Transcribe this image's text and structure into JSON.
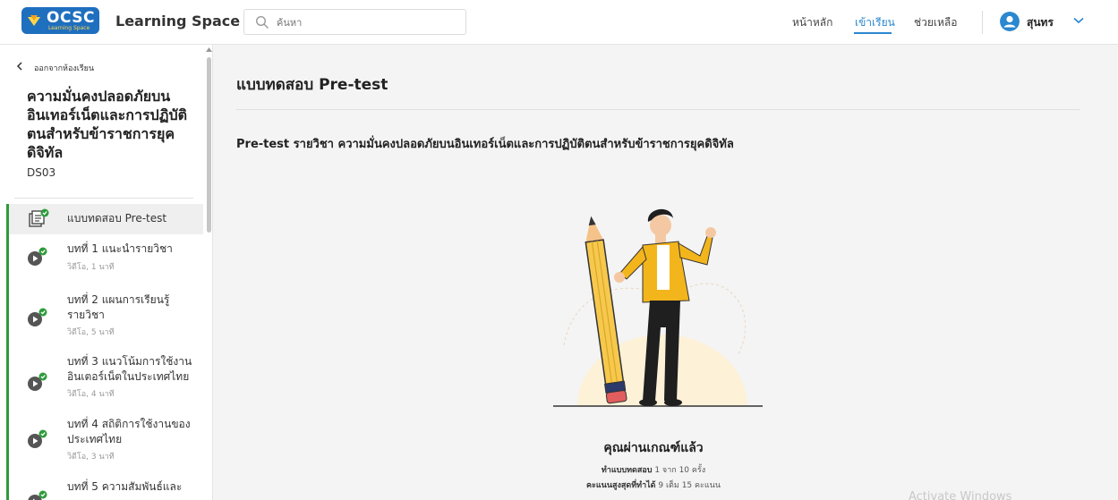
{
  "header": {
    "logo_text": "OCSC",
    "logo_sub": "Learning Space",
    "brand": "Learning Space",
    "search_placeholder": "ค้นหา",
    "nav": {
      "home": "หน้าหลัก",
      "study": "เข้าเรียน",
      "help": "ช่วยเหลือ"
    },
    "user_name": "สุนทร",
    "accent_color": "#2a87d0"
  },
  "sidebar": {
    "back_label": "ออกจากห้องเรียน",
    "course_title": "ความมั่นคงปลอดภัยบนอินเทอร์เน็ตและการปฏิบัติตนสำหรับข้าราชการยุคดิจิทัล",
    "course_code": "DS03",
    "progress_color": "#2e9b3a",
    "items": [
      {
        "label": "แบบทดสอบ Pre-test",
        "sub": "",
        "icon": "quiz-done-icon"
      },
      {
        "label": "บทที่ 1 แนะนำรายวิชา",
        "sub": "วิดีโอ, 1 นาที",
        "icon": "video-done-icon"
      },
      {
        "label": "บทที่ 2 แผนการเรียนรู้รายวิชา",
        "sub": "วิดีโอ, 5 นาที",
        "icon": "video-done-icon"
      },
      {
        "label": "บทที่ 3 แนวโน้มการใช้งานอินเตอร์เน็ตในประเทศไทย",
        "sub": "วิดีโอ, 4 นาที",
        "icon": "video-done-icon"
      },
      {
        "label": "บทที่ 4 สถิติการใช้งานของประเทศไทย",
        "sub": "วิดีโอ, 3 นาที",
        "icon": "video-done-icon"
      },
      {
        "label": "บทที่ 5 ความสัมพันธ์และ",
        "sub": "",
        "icon": "video-done-icon"
      }
    ]
  },
  "main": {
    "title": "แบบทดสอบ Pre-test",
    "subtitle": "Pre-test รายวิชา ความมั่นคงปลอดภัยบนอินเทอร์เน็ตและการปฏิบัติตนสำหรับข้าราชการยุคดิจิทัล",
    "result_title": "คุณผ่านเกณฑ์แล้ว",
    "attempts_label": "ทำแบบทดสอบ",
    "attempts_value": "1 จาก 10 ครั้ง",
    "best_label": "คะแนนสูงสุดที่ทำได้",
    "best_value": "9 เต็ม 15 คะแนน"
  },
  "watermark": "Activate Windows"
}
